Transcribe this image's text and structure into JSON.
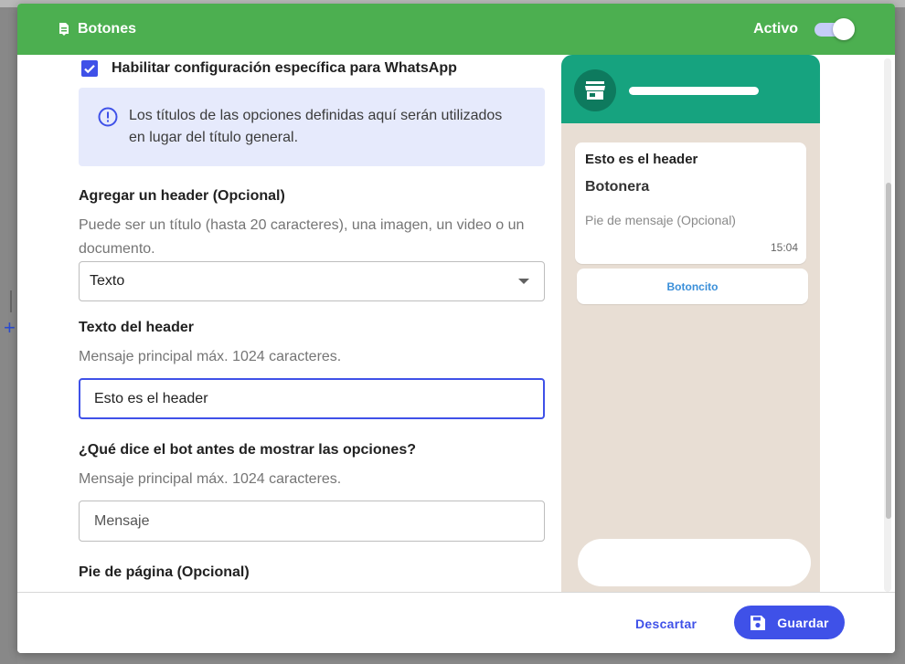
{
  "modal": {
    "title": "Botones",
    "active_label": "Activo",
    "active_on": true,
    "accent_color": "#4caf50"
  },
  "form": {
    "whatsapp_checkbox": {
      "label": "Habilitar configuración específica para WhatsApp",
      "checked": true
    },
    "info_text": "Los títulos de las opciones definidas aquí serán utilizados en lugar del título general.",
    "header_section": {
      "label": "Agregar un header (Opcional)",
      "hint": "Puede ser un título (hasta 20 caracteres), una imagen, un video o un documento.",
      "select_value": "Texto"
    },
    "header_text": {
      "label": "Texto del header",
      "hint": "Mensaje principal máx. 1024 caracteres.",
      "value": "Esto es el header"
    },
    "bot_message": {
      "label": "¿Qué dice el bot antes de mostrar las opciones?",
      "hint": "Mensaje principal máx. 1024 caracteres.",
      "placeholder": "Mensaje"
    },
    "footer_section": {
      "label": "Pie de página (Opcional)"
    }
  },
  "preview": {
    "header": "Esto es el header",
    "body": "Botonera",
    "footer": "Pie de mensaje (Opcional)",
    "time": "15:04",
    "button_label": "Botoncito",
    "whatsapp_color": "#16a37f"
  },
  "actions": {
    "discard_label": "Descartar",
    "save_label": "Guardar"
  }
}
